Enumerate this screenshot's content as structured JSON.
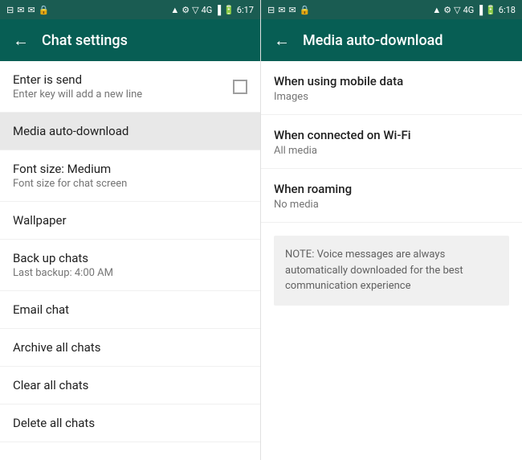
{
  "left_panel": {
    "status_bar": {
      "left_icons": "⊟ ✉ ✉ 🔒",
      "signal": "4G",
      "time": "6:17"
    },
    "app_bar": {
      "back_label": "←",
      "title": "Chat settings"
    },
    "items": [
      {
        "id": "enter-is-send",
        "title": "Enter is send",
        "subtitle": "Enter key will add a new line",
        "has_checkbox": true,
        "checked": false,
        "highlighted": false
      },
      {
        "id": "media-auto-download",
        "title": "Media auto-download",
        "subtitle": "",
        "has_checkbox": false,
        "highlighted": true
      },
      {
        "id": "font-size",
        "title": "Font size: Medium",
        "subtitle": "Font size for chat screen",
        "has_checkbox": false,
        "highlighted": false
      },
      {
        "id": "wallpaper",
        "title": "Wallpaper",
        "subtitle": "",
        "has_checkbox": false,
        "highlighted": false
      },
      {
        "id": "back-up-chats",
        "title": "Back up chats",
        "subtitle": "Last backup: 4:00 AM",
        "has_checkbox": false,
        "highlighted": false
      },
      {
        "id": "email-chat",
        "title": "Email chat",
        "subtitle": "",
        "has_checkbox": false,
        "highlighted": false
      },
      {
        "id": "archive-all-chats",
        "title": "Archive all chats",
        "subtitle": "",
        "has_checkbox": false,
        "highlighted": false
      },
      {
        "id": "clear-all-chats",
        "title": "Clear all chats",
        "subtitle": "",
        "has_checkbox": false,
        "highlighted": false
      },
      {
        "id": "delete-all-chats",
        "title": "Delete all chats",
        "subtitle": "",
        "has_checkbox": false,
        "highlighted": false
      }
    ]
  },
  "right_panel": {
    "status_bar": {
      "left_icons": "⊟ ✉ ✉ 🔒",
      "signal": "4G",
      "time": "6:18"
    },
    "app_bar": {
      "back_label": "←",
      "title": "Media auto-download"
    },
    "items": [
      {
        "id": "mobile-data",
        "title": "When using mobile data",
        "subtitle": "Images"
      },
      {
        "id": "wifi",
        "title": "When connected on Wi-Fi",
        "subtitle": "All media"
      },
      {
        "id": "roaming",
        "title": "When roaming",
        "subtitle": "No media"
      }
    ],
    "note": "NOTE: Voice messages are always automatically downloaded for the best communication experience"
  }
}
